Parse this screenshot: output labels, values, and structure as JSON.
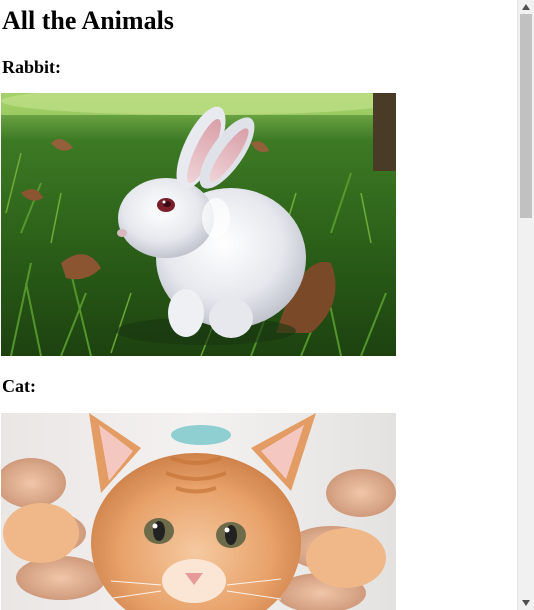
{
  "page": {
    "title": "All the Animals"
  },
  "sections": [
    {
      "heading": "Rabbit:",
      "image_subject": "white rabbit sitting on grass"
    },
    {
      "heading": "Cat:",
      "image_subject": "orange tabby kitten held in hands"
    }
  ],
  "scrollbar": {
    "up_icon": "triangle-up-icon",
    "down_icon": "triangle-down-icon"
  }
}
